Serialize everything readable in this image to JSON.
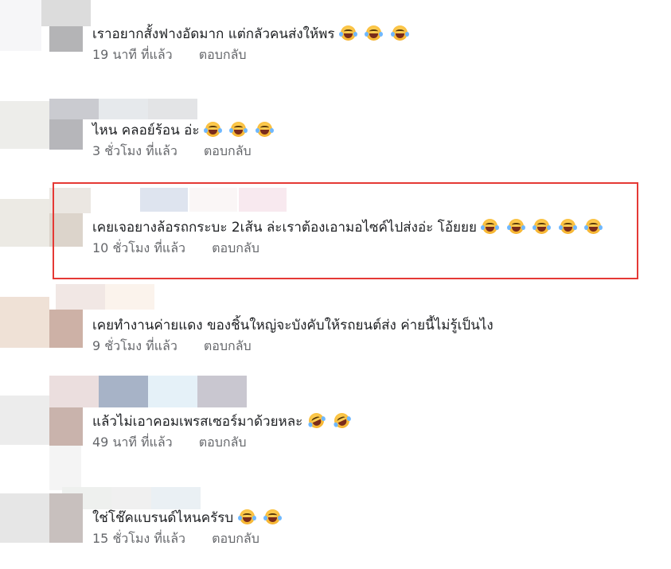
{
  "comments": [
    {
      "text": "เราอยากสั้งฟางอัดมาก แต่กลัวคนส่งให้พร",
      "emojis": [
        "laughing-tears",
        "laughing-tears",
        "laughing-tears"
      ],
      "time": "19 นาที ที่แล้ว",
      "reply": "ตอบกลับ"
    },
    {
      "text": "ไหน คลอย์ร้อน อ่ะ",
      "emojis": [
        "laughing-tears",
        "laughing-tears",
        "laughing-tears"
      ],
      "time": "3 ชั่วโมง ที่แล้ว",
      "reply": "ตอบกลับ"
    },
    {
      "text": "เคยเจอยางล้อรถกระบะ 2เส้น ล่ะเราต้องเอามอไซค์ไปส่งอ่ะ โอ้ยยย",
      "emojis": [
        "laughing-tears",
        "laughing-tears",
        "laughing-tears",
        "laughing-tears",
        "laughing-tears"
      ],
      "time": "10 ชั่วโมง ที่แล้ว",
      "reply": "ตอบกลับ"
    },
    {
      "text": "เคยทำงานค่ายแดง ของชิ้นใหญ่จะบังคับให้รถยนต์ส่ง ค่ายนี้ไม่รู้เป็นไง",
      "emojis": [],
      "time": "9 ชั่วโมง ที่แล้ว",
      "reply": "ตอบกลับ"
    },
    {
      "text": "แล้วไม่เอาคอมเพรสเซอร์มาด้วยหละ",
      "emojis": [
        "rofl",
        "rofl"
      ],
      "time": "49 นาที ที่แล้ว",
      "reply": "ตอบกลับ"
    },
    {
      "text": "ใช่โช๊คแบรนด์ไหนครัรบ",
      "emojis": [
        "laughing-tears",
        "laughing-tears"
      ],
      "time": "15 ชั่วโมง ที่แล้ว",
      "reply": "ตอบกลับ"
    }
  ],
  "colors": {
    "highlight_border": "#e53935",
    "text": "#1c1e21",
    "meta": "#65676b"
  }
}
